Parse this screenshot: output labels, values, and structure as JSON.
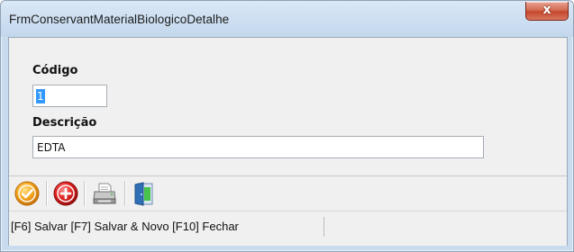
{
  "window": {
    "title": "FrmConservantMaterialBiologicoDetalhe",
    "close_glyph": "x"
  },
  "form": {
    "codigo_label": "Código",
    "codigo_value": "1",
    "descricao_label": "Descrição",
    "descricao_value": "EDTA"
  },
  "toolbar": {
    "buttons": [
      {
        "icon": "check-circle-icon",
        "color": "#f0a020"
      },
      {
        "icon": "add-circle-icon",
        "color": "#d81e1e"
      },
      {
        "icon": "printer-icon",
        "color": "#7a7a7a"
      },
      {
        "icon": "exit-door-icon",
        "color": "#2f6fb5"
      }
    ]
  },
  "statusbar": {
    "text": "[F6] Salvar [F7] Salvar & Novo [F10] Fechar"
  }
}
